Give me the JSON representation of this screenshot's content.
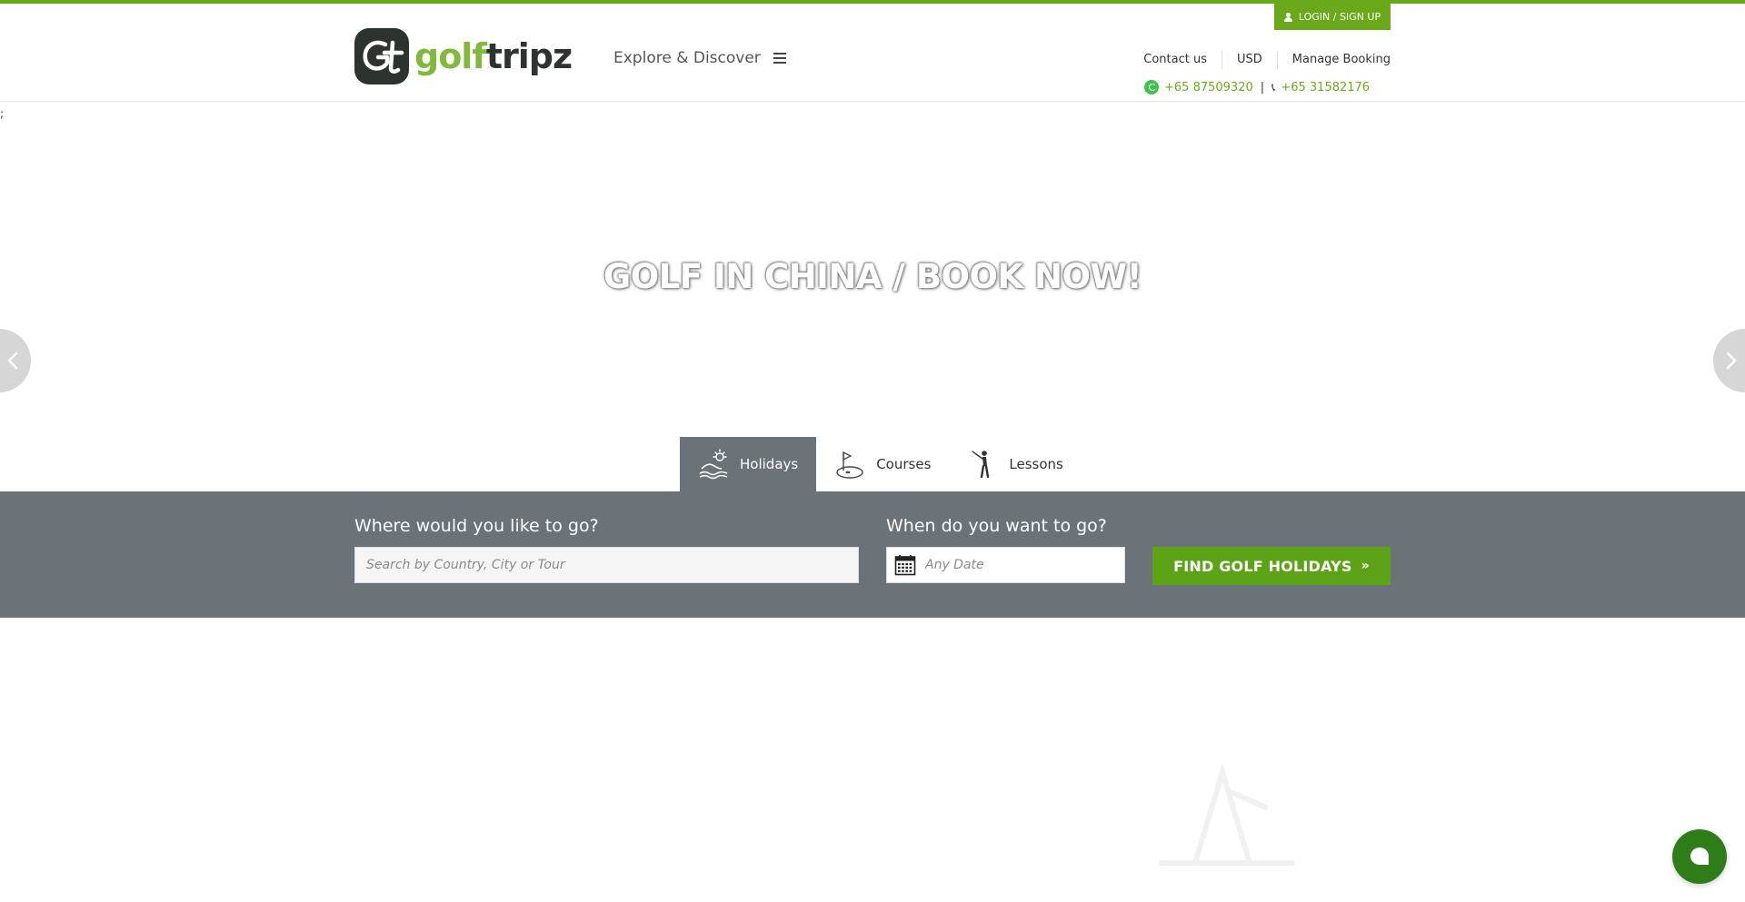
{
  "brand": {
    "logo_part1": "golf",
    "logo_part2": "tripz",
    "logo_mark": "Gt"
  },
  "header": {
    "explore_label": "Explore & Discover",
    "login_label": "LOGIN / SIGN UP",
    "nav": [
      "Contact us",
      "USD",
      "Manage Booking"
    ],
    "whatsapp_phone": "+65 87509320",
    "separator": "|",
    "phone": "+65 31582176"
  },
  "stray_text": ";",
  "hero": {
    "title": "GOLF IN CHINA / BOOK NOW!"
  },
  "tabs": [
    {
      "label": "Holidays",
      "icon": "holiday-icon",
      "active": true
    },
    {
      "label": "Courses",
      "icon": "golf-course-icon",
      "active": false
    },
    {
      "label": "Lessons",
      "icon": "golfer-icon",
      "active": false
    }
  ],
  "search": {
    "where_label": "Where would you like to go?",
    "where_placeholder": "Search by Country, City or Tour",
    "when_label": "When do you want to go?",
    "when_placeholder": "Any Date",
    "button_label": "FIND GOLF HOLIDAYS",
    "button_chevron": "»"
  },
  "colors": {
    "accent": "#6aaa1a",
    "button": "#5da317",
    "band": "#6b7278",
    "logo_dark": "#2d3430",
    "chat": "#2f7d18"
  }
}
